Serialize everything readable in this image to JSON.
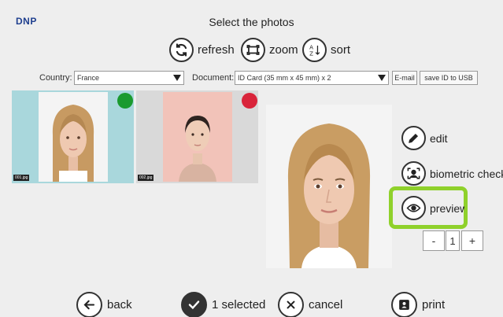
{
  "header": {
    "logo": "DNP",
    "title": "Select the photos"
  },
  "toolbar": {
    "refresh_label": "refresh",
    "zoom_label": "zoom",
    "sort_label": "sort"
  },
  "filters": {
    "country_label": "Country:",
    "country_value": "France",
    "document_label": "Document:",
    "document_value": "ID Card (35 mm x 45 mm) x 2",
    "email_label": "E-mail",
    "save_label": "save ID to USB"
  },
  "thumbnails": [
    {
      "filename": "001.jpg",
      "status_color": "#1a9a2f",
      "selected": true
    },
    {
      "filename": "002.jpg",
      "status_color": "#d9243a",
      "selected": false
    }
  ],
  "side_actions": {
    "edit_label": "edit",
    "biometric_label": "biometric check",
    "preview_label": "preview"
  },
  "copies": {
    "minus": "-",
    "value": "1",
    "plus": "+"
  },
  "bottom": {
    "back_label": "back",
    "selected_label": "1 selected",
    "cancel_label": "cancel",
    "print_label": "print"
  },
  "colors": {
    "highlight": "#8fd12b",
    "logo": "#1f3f8f"
  }
}
